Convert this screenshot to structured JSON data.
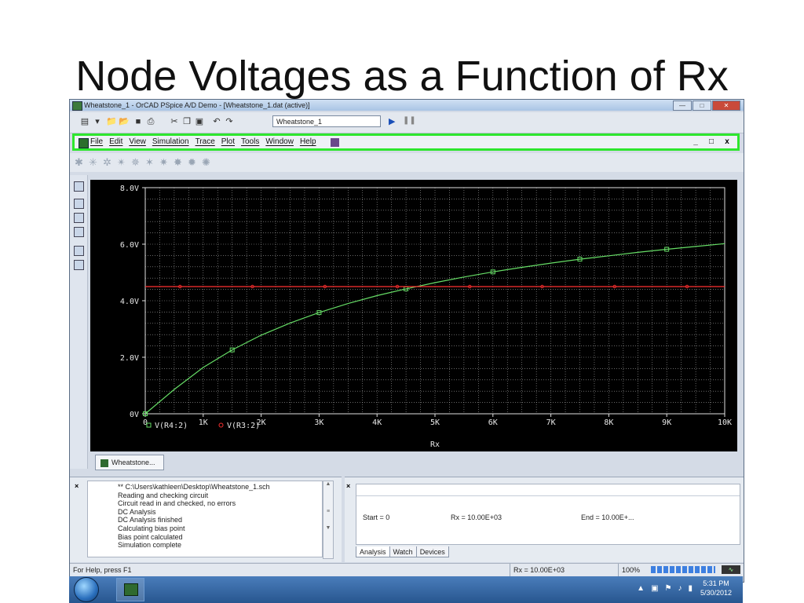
{
  "slide": {
    "title": "Node Voltages as a Function of Rx"
  },
  "window": {
    "title": "Wheatstone_1 - OrCAD PSpice A/D Demo  - [Wheatstone_1.dat (active)]",
    "profile_value": "Wheatstone_1"
  },
  "menu": {
    "items": [
      "File",
      "Edit",
      "View",
      "Simulation",
      "Trace",
      "Plot",
      "Tools",
      "Window",
      "Help"
    ],
    "mdi_min": "_",
    "mdi_restore": "□",
    "mdi_close": "x"
  },
  "colors": {
    "trace_r4": "#66dd66",
    "trace_r3": "#ff3030",
    "grid": "#cfcfcf",
    "menu_highlight": "#2ee62e"
  },
  "chart_data": {
    "type": "line",
    "xlabel": "Rx",
    "x_tick_labels": [
      "0",
      "1K",
      "2K",
      "3K",
      "4K",
      "5K",
      "6K",
      "7K",
      "8K",
      "9K",
      "10K"
    ],
    "y_tick_labels": [
      "0V",
      "2.0V",
      "4.0V",
      "6.0V",
      "8.0V"
    ],
    "xlim": [
      0,
      10000
    ],
    "ylim": [
      0,
      8
    ],
    "grid": true,
    "legend": "bottom-left",
    "series": [
      {
        "name": "V(R4:2)",
        "x": [
          0,
          500,
          1000,
          1500,
          2000,
          2500,
          3000,
          3500,
          4000,
          4500,
          5000,
          5500,
          6000,
          6500,
          7000,
          7500,
          8000,
          8500,
          9000,
          9500,
          10000
        ],
        "y": [
          0.0,
          0.86,
          1.64,
          2.26,
          2.78,
          3.21,
          3.58,
          3.9,
          4.18,
          4.42,
          4.64,
          4.84,
          5.02,
          5.18,
          5.33,
          5.47,
          5.59,
          5.71,
          5.82,
          5.92,
          6.02
        ]
      },
      {
        "name": "V(R3:2)",
        "x": [
          0,
          10000
        ],
        "y": [
          4.5,
          4.5
        ]
      }
    ]
  },
  "doc_tab": {
    "label": "Wheatstone..."
  },
  "output": {
    "lines": [
      "** C:\\Users\\kathleen\\Desktop\\Wheatstone_1.sch",
      "Reading and checking circuit",
      "Circuit read in and checked, no errors",
      "DC Analysis",
      "DC Analysis finished",
      "Calculating bias point",
      "Bias point calculated",
      "Simulation complete"
    ]
  },
  "sim_status": {
    "start": "Start = 0",
    "rx": "Rx =  10.00E+03",
    "end": "End =  10.00E+...",
    "tabs": [
      "Analysis",
      "Watch",
      "Devices"
    ]
  },
  "status_bar": {
    "help": "For Help, press F1",
    "rx": "Rx =  10.00E+03",
    "percent": "100%",
    "progress": 1.0
  },
  "taskbar": {
    "time": "5:31 PM",
    "date": "5/30/2012"
  }
}
